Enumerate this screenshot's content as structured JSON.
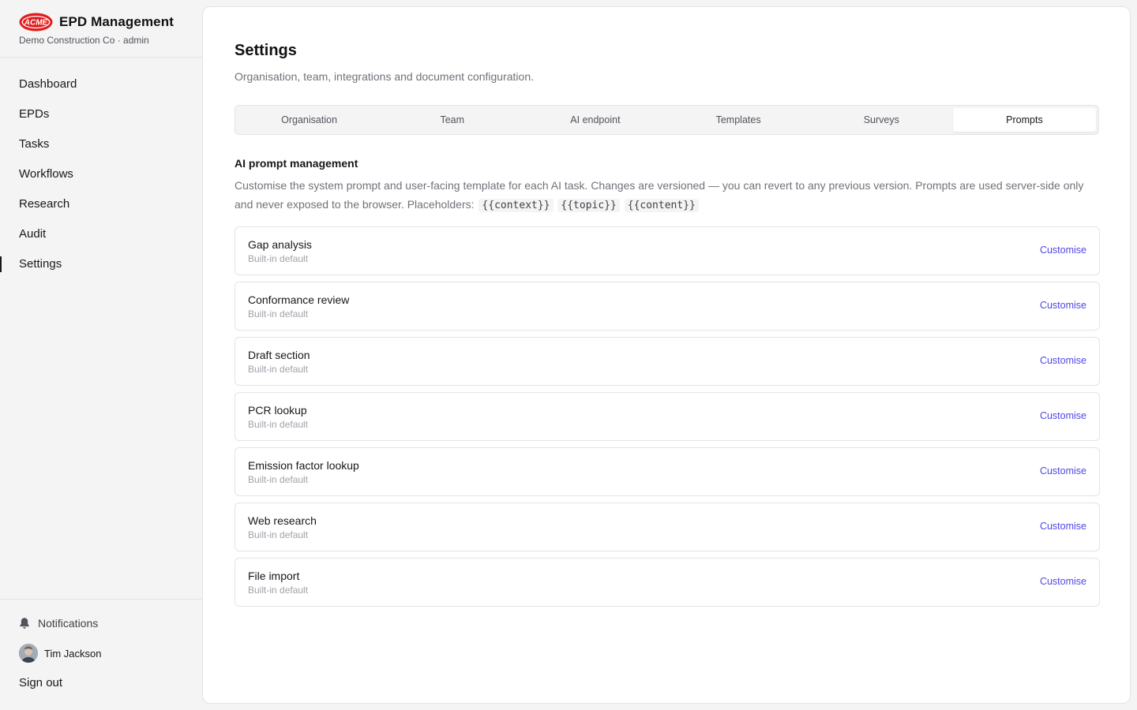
{
  "brand": {
    "logo_text": "ACME",
    "title": "EPD Management",
    "subtitle": "Demo Construction Co · admin",
    "logo_color": "#e11d1d"
  },
  "nav": {
    "items": [
      {
        "label": "Dashboard",
        "active": false
      },
      {
        "label": "EPDs",
        "active": false
      },
      {
        "label": "Tasks",
        "active": false
      },
      {
        "label": "Workflows",
        "active": false
      },
      {
        "label": "Research",
        "active": false
      },
      {
        "label": "Audit",
        "active": false
      },
      {
        "label": "Settings",
        "active": true
      }
    ]
  },
  "footer": {
    "notifications_label": "Notifications",
    "user_name": "Tim Jackson",
    "signout_label": "Sign out"
  },
  "page": {
    "title": "Settings",
    "subtitle": "Organisation, team, integrations and document configuration."
  },
  "tabs": [
    {
      "label": "Organisation",
      "active": false
    },
    {
      "label": "Team",
      "active": false
    },
    {
      "label": "AI endpoint",
      "active": false
    },
    {
      "label": "Templates",
      "active": false
    },
    {
      "label": "Surveys",
      "active": false
    },
    {
      "label": "Prompts",
      "active": true
    }
  ],
  "prompts_section": {
    "title": "AI prompt management",
    "description": "Customise the system prompt and user-facing template for each AI task. Changes are versioned — you can revert to any previous version. Prompts are used server-side only and never exposed to the browser. Placeholders:",
    "placeholders": [
      "{{context}}",
      "{{topic}}",
      "{{content}}"
    ],
    "items": [
      {
        "name": "Gap analysis",
        "meta": "Built-in default",
        "action": "Customise"
      },
      {
        "name": "Conformance review",
        "meta": "Built-in default",
        "action": "Customise"
      },
      {
        "name": "Draft section",
        "meta": "Built-in default",
        "action": "Customise"
      },
      {
        "name": "PCR lookup",
        "meta": "Built-in default",
        "action": "Customise"
      },
      {
        "name": "Emission factor lookup",
        "meta": "Built-in default",
        "action": "Customise"
      },
      {
        "name": "Web research",
        "meta": "Built-in default",
        "action": "Customise"
      },
      {
        "name": "File import",
        "meta": "Built-in default",
        "action": "Customise"
      }
    ]
  },
  "colors": {
    "accent": "#4f46e5",
    "background": "#f4f4f5",
    "panel": "#ffffff"
  }
}
